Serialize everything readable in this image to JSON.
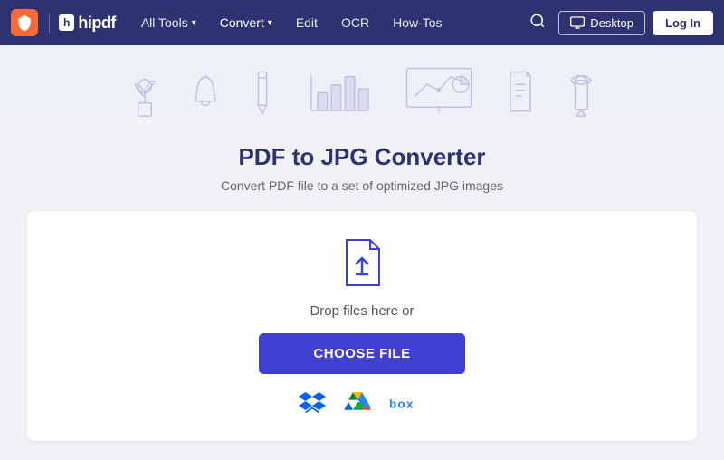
{
  "brand": {
    "wondershare_logo_label": "Wondershare",
    "hipdf_short": "h",
    "hipdf_name": "hipdf"
  },
  "navbar": {
    "all_tools": "All Tools",
    "convert": "Convert",
    "edit": "Edit",
    "ocr": "OCR",
    "how_tos": "How-Tos",
    "desktop_btn": "Desktop",
    "login_btn": "Log In"
  },
  "page": {
    "title": "PDF to JPG Converter",
    "subtitle": "Convert PDF file to a set of optimized JPG images"
  },
  "upload": {
    "drop_text": "Drop files here or",
    "choose_file_btn": "CHOOSE FILE"
  },
  "cloud": {
    "dropbox_label": "Dropbox",
    "gdrive_label": "Google Drive",
    "box_label": "box"
  }
}
